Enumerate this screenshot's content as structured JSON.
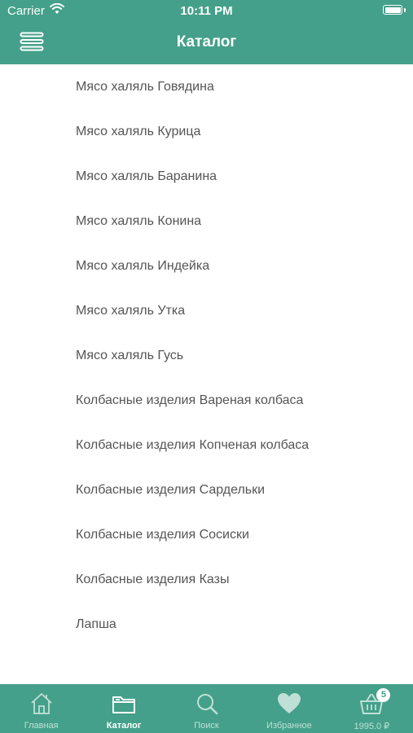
{
  "status_bar": {
    "carrier": "Carrier",
    "time": "10:11 PM",
    "icons": [
      "wifi-icon",
      "battery-icon"
    ]
  },
  "nav": {
    "title": "Каталог",
    "menu_icon": "hamburger-menu-icon"
  },
  "catalog": {
    "items": [
      "Мясо халяль Говядина",
      "Мясо халяль Курица",
      "Мясо халяль Баранина",
      "Мясо халяль Конина",
      "Мясо халяль Индейка",
      "Мясо халяль Утка",
      "Мясо халяль Гусь",
      "Колбасные изделия Вареная колбаса",
      "Колбасные изделия Копченая колбаса",
      "Колбасные изделия Сардельки",
      "Колбасные изделия Сосиски",
      "Колбасные изделия Казы",
      "Лапша"
    ]
  },
  "tabbar": {
    "tabs": [
      {
        "label": "Главная",
        "icon": "home-icon",
        "active": false
      },
      {
        "label": "Каталог",
        "icon": "folder-icon",
        "active": true
      },
      {
        "label": "Поиск",
        "icon": "search-icon",
        "active": false
      },
      {
        "label": "Избранное",
        "icon": "heart-icon",
        "active": false
      },
      {
        "label": "1995.0 ₽",
        "icon": "basket-icon",
        "active": false
      }
    ],
    "cart_badge": "5"
  },
  "colors": {
    "accent": "#44a08a",
    "item_text": "#555555",
    "inactive_tab": "#bfe0d7"
  }
}
